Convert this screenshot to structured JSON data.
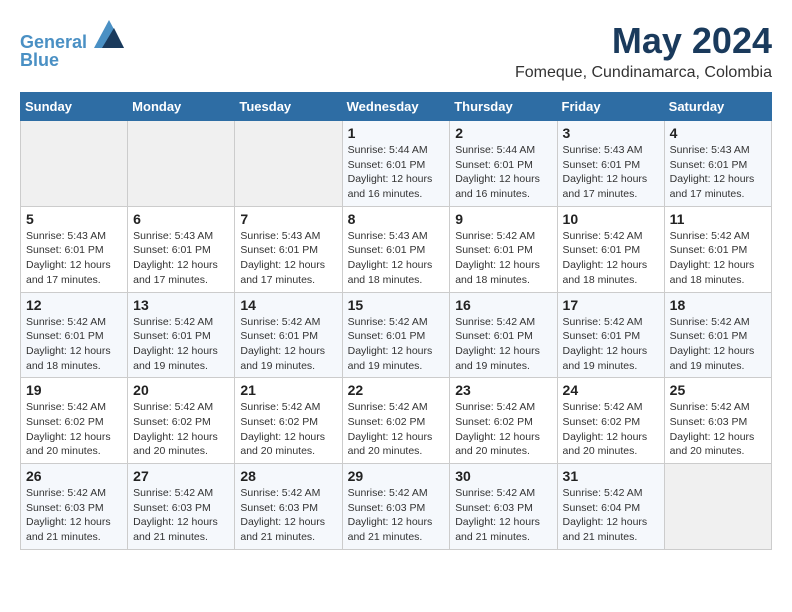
{
  "logo": {
    "line1": "General",
    "line2": "Blue"
  },
  "title": "May 2024",
  "location": "Fomeque, Cundinamarca, Colombia",
  "days_of_week": [
    "Sunday",
    "Monday",
    "Tuesday",
    "Wednesday",
    "Thursday",
    "Friday",
    "Saturday"
  ],
  "weeks": [
    [
      {
        "day": "",
        "info": ""
      },
      {
        "day": "",
        "info": ""
      },
      {
        "day": "",
        "info": ""
      },
      {
        "day": "1",
        "info": "Sunrise: 5:44 AM\nSunset: 6:01 PM\nDaylight: 12 hours and 16 minutes."
      },
      {
        "day": "2",
        "info": "Sunrise: 5:44 AM\nSunset: 6:01 PM\nDaylight: 12 hours and 16 minutes."
      },
      {
        "day": "3",
        "info": "Sunrise: 5:43 AM\nSunset: 6:01 PM\nDaylight: 12 hours and 17 minutes."
      },
      {
        "day": "4",
        "info": "Sunrise: 5:43 AM\nSunset: 6:01 PM\nDaylight: 12 hours and 17 minutes."
      }
    ],
    [
      {
        "day": "5",
        "info": "Sunrise: 5:43 AM\nSunset: 6:01 PM\nDaylight: 12 hours and 17 minutes."
      },
      {
        "day": "6",
        "info": "Sunrise: 5:43 AM\nSunset: 6:01 PM\nDaylight: 12 hours and 17 minutes."
      },
      {
        "day": "7",
        "info": "Sunrise: 5:43 AM\nSunset: 6:01 PM\nDaylight: 12 hours and 17 minutes."
      },
      {
        "day": "8",
        "info": "Sunrise: 5:43 AM\nSunset: 6:01 PM\nDaylight: 12 hours and 18 minutes."
      },
      {
        "day": "9",
        "info": "Sunrise: 5:42 AM\nSunset: 6:01 PM\nDaylight: 12 hours and 18 minutes."
      },
      {
        "day": "10",
        "info": "Sunrise: 5:42 AM\nSunset: 6:01 PM\nDaylight: 12 hours and 18 minutes."
      },
      {
        "day": "11",
        "info": "Sunrise: 5:42 AM\nSunset: 6:01 PM\nDaylight: 12 hours and 18 minutes."
      }
    ],
    [
      {
        "day": "12",
        "info": "Sunrise: 5:42 AM\nSunset: 6:01 PM\nDaylight: 12 hours and 18 minutes."
      },
      {
        "day": "13",
        "info": "Sunrise: 5:42 AM\nSunset: 6:01 PM\nDaylight: 12 hours and 19 minutes."
      },
      {
        "day": "14",
        "info": "Sunrise: 5:42 AM\nSunset: 6:01 PM\nDaylight: 12 hours and 19 minutes."
      },
      {
        "day": "15",
        "info": "Sunrise: 5:42 AM\nSunset: 6:01 PM\nDaylight: 12 hours and 19 minutes."
      },
      {
        "day": "16",
        "info": "Sunrise: 5:42 AM\nSunset: 6:01 PM\nDaylight: 12 hours and 19 minutes."
      },
      {
        "day": "17",
        "info": "Sunrise: 5:42 AM\nSunset: 6:01 PM\nDaylight: 12 hours and 19 minutes."
      },
      {
        "day": "18",
        "info": "Sunrise: 5:42 AM\nSunset: 6:01 PM\nDaylight: 12 hours and 19 minutes."
      }
    ],
    [
      {
        "day": "19",
        "info": "Sunrise: 5:42 AM\nSunset: 6:02 PM\nDaylight: 12 hours and 20 minutes."
      },
      {
        "day": "20",
        "info": "Sunrise: 5:42 AM\nSunset: 6:02 PM\nDaylight: 12 hours and 20 minutes."
      },
      {
        "day": "21",
        "info": "Sunrise: 5:42 AM\nSunset: 6:02 PM\nDaylight: 12 hours and 20 minutes."
      },
      {
        "day": "22",
        "info": "Sunrise: 5:42 AM\nSunset: 6:02 PM\nDaylight: 12 hours and 20 minutes."
      },
      {
        "day": "23",
        "info": "Sunrise: 5:42 AM\nSunset: 6:02 PM\nDaylight: 12 hours and 20 minutes."
      },
      {
        "day": "24",
        "info": "Sunrise: 5:42 AM\nSunset: 6:02 PM\nDaylight: 12 hours and 20 minutes."
      },
      {
        "day": "25",
        "info": "Sunrise: 5:42 AM\nSunset: 6:03 PM\nDaylight: 12 hours and 20 minutes."
      }
    ],
    [
      {
        "day": "26",
        "info": "Sunrise: 5:42 AM\nSunset: 6:03 PM\nDaylight: 12 hours and 21 minutes."
      },
      {
        "day": "27",
        "info": "Sunrise: 5:42 AM\nSunset: 6:03 PM\nDaylight: 12 hours and 21 minutes."
      },
      {
        "day": "28",
        "info": "Sunrise: 5:42 AM\nSunset: 6:03 PM\nDaylight: 12 hours and 21 minutes."
      },
      {
        "day": "29",
        "info": "Sunrise: 5:42 AM\nSunset: 6:03 PM\nDaylight: 12 hours and 21 minutes."
      },
      {
        "day": "30",
        "info": "Sunrise: 5:42 AM\nSunset: 6:03 PM\nDaylight: 12 hours and 21 minutes."
      },
      {
        "day": "31",
        "info": "Sunrise: 5:42 AM\nSunset: 6:04 PM\nDaylight: 12 hours and 21 minutes."
      },
      {
        "day": "",
        "info": ""
      }
    ]
  ]
}
